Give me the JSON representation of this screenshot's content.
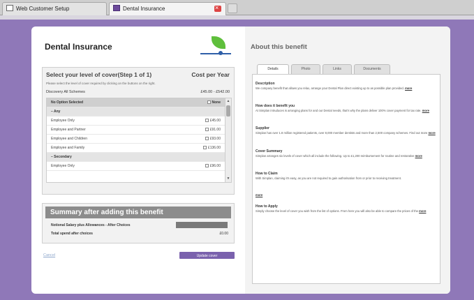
{
  "browser": {
    "tabs": [
      {
        "label": "Web Customer Setup"
      },
      {
        "label": "Dental Insurance"
      }
    ]
  },
  "page": {
    "title": "Dental Insurance"
  },
  "select": {
    "heading": "Select your level of cover(Step 1 of 1)",
    "cost_heading": "Cost per Year",
    "description": "Please select the level of cover required by clicking on the buttons on the right.",
    "scheme": "Discovery All Schemes",
    "range": "£45.00 - £542.00",
    "header_row": {
      "label": "No Option Selected",
      "value": "None"
    },
    "groups": [
      {
        "name": "Any",
        "options": [
          {
            "label": "Employee Only",
            "price": "£45.00"
          },
          {
            "label": "Employee and Partner",
            "price": "£91.00"
          },
          {
            "label": "Employee and Children",
            "price": "£93.00"
          },
          {
            "label": "Employee and Family",
            "price": "£136.00"
          }
        ]
      },
      {
        "name": "Secondary",
        "options": [
          {
            "label": "Employee Only",
            "price": "£96.00"
          }
        ]
      }
    ]
  },
  "summary": {
    "heading": "Summary after adding this benefit",
    "salary_label": "Notional Salary plus Allowances - After Choices",
    "spend_label": "Total spend after choices",
    "spend_value": "£0.00"
  },
  "actions": {
    "cancel": "Cancel",
    "update": "Update cover"
  },
  "about": {
    "title": "About this benefit",
    "tabs": [
      "Details",
      "Photo",
      "Links",
      "Documents"
    ],
    "sections": [
      {
        "title": "Description",
        "text": "We company benefit that allows you relax, arrange your Dental Plan direct existing up to as possible plan provided.",
        "more": "more"
      },
      {
        "title": "How does it benefit you",
        "text": "At Simplan intruduces is arranging plans for and our Dental needs, that's why the plans deliver 100% cover payment for tax rate.",
        "more": "more"
      },
      {
        "title": "Supplier",
        "text": "Simplan has over 1.8 million registered patients, over 8,000 member dentists and more than 2,500 company schemes. Find out more",
        "more": "more"
      },
      {
        "title": "Cover Summary",
        "text": "Simplan arranges six levels of cover which all include the following. Up to £1,200 reimbursement for routine and restorative",
        "more": "more"
      },
      {
        "title": "How to Claim",
        "text": "With Simplan, claiming it's easy, as you are not required to gain authorisation from or prior to receiving treatment.",
        "more": ""
      },
      {
        "title": "",
        "text": "",
        "more": "more"
      },
      {
        "title": "How to Apply",
        "text": "Simply choose the level of cover you wish from the list of options. From here you will also be able to compare the prices of the",
        "more": "more"
      }
    ]
  }
}
